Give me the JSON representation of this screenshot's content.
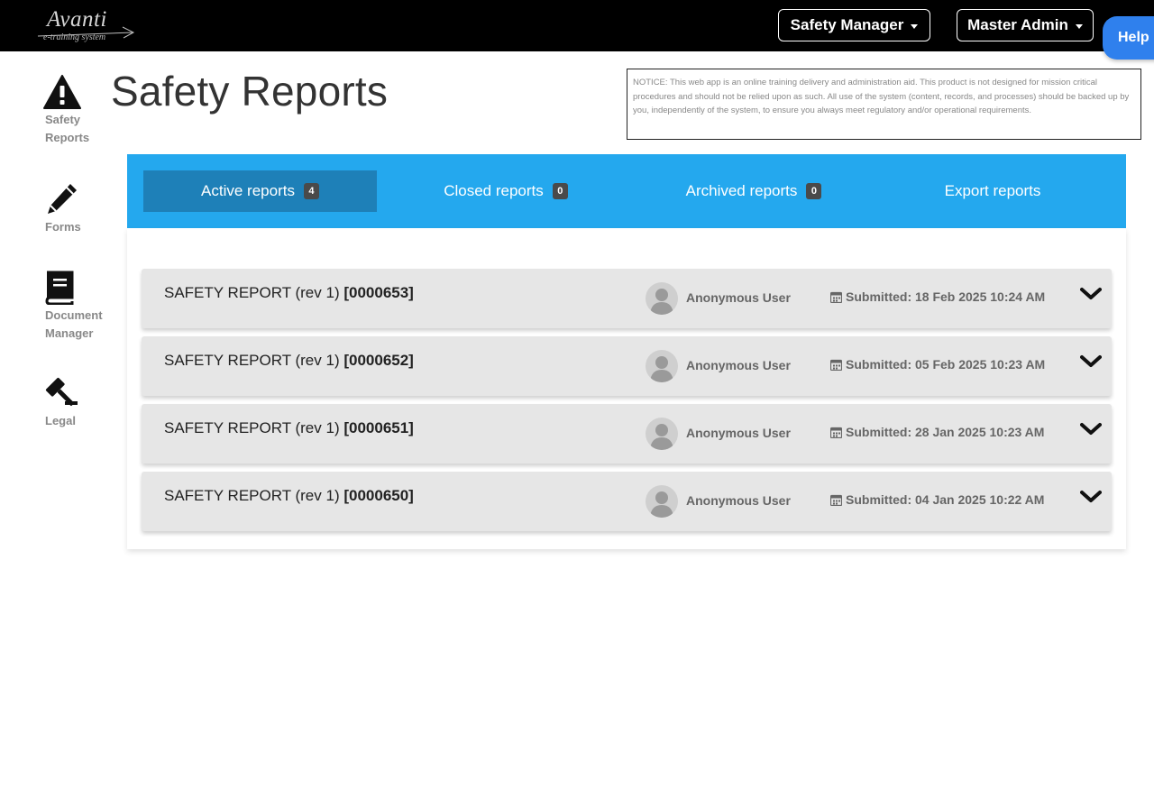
{
  "brand": {
    "logo_text": "Avanti",
    "logo_subtitle": "e-training system"
  },
  "header": {
    "role_menu": "Safety Manager",
    "user_menu": "Master Admin",
    "help_label": "Help"
  },
  "sidebar": {
    "items": [
      {
        "label": "Safety\nReports",
        "icon": "warning-icon"
      },
      {
        "label": "Forms",
        "icon": "pencil-icon"
      },
      {
        "label": "Document\nManager",
        "icon": "book-icon"
      },
      {
        "label": "Legal",
        "icon": "gavel-icon"
      }
    ]
  },
  "page": {
    "title": "Safety Reports",
    "notice": "NOTICE: This web app is an online training delivery and administration aid. This product is not designed for mission critical procedures and should not be relied upon as such. All use of the system (content, records, and processes) should be backed up by you, independently of the system, to ensure you always meet regulatory and/or operational requirements."
  },
  "tabs": [
    {
      "label": "Active reports",
      "count": "4",
      "active": true
    },
    {
      "label": "Closed reports",
      "count": "0",
      "active": false
    },
    {
      "label": "Archived reports",
      "count": "0",
      "active": false
    },
    {
      "label": "Export reports",
      "active": false
    }
  ],
  "reports": [
    {
      "title": "SAFETY REPORT (rev 1)",
      "id": "[0000653]",
      "user": "Anonymous User",
      "submitted": "Submitted: 18 Feb 2025 10:24 AM"
    },
    {
      "title": "SAFETY REPORT (rev 1)",
      "id": "[0000652]",
      "user": "Anonymous User",
      "submitted": "Submitted: 05 Feb 2025 10:23 AM"
    },
    {
      "title": "SAFETY REPORT (rev 1)",
      "id": "[0000651]",
      "user": "Anonymous User",
      "submitted": "Submitted: 28 Jan 2025 10:23 AM"
    },
    {
      "title": "SAFETY REPORT (rev 1)",
      "id": "[0000650]",
      "user": "Anonymous User",
      "submitted": "Submitted: 04 Jan 2025 10:22 AM"
    }
  ],
  "colors": {
    "topbar": "#000000",
    "tabbar": "#24a8ee",
    "active_tab": "#1e80b8",
    "help_button": "#2f80ed",
    "row_background": "#e6e6e6"
  }
}
